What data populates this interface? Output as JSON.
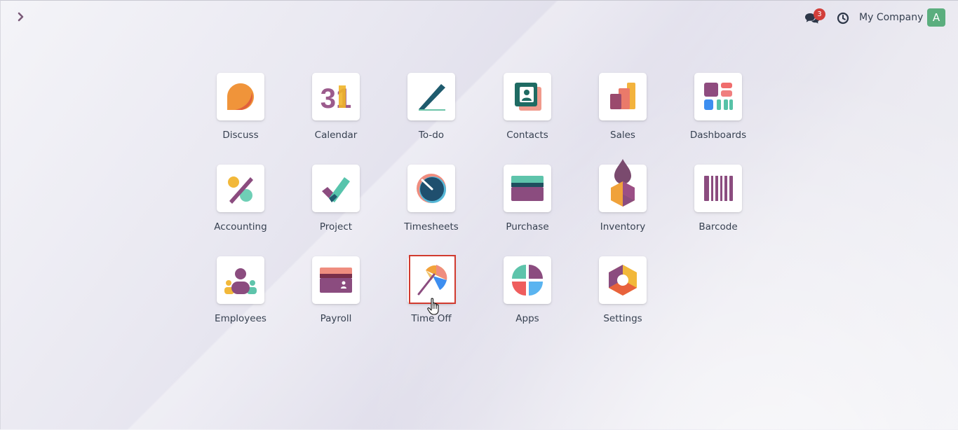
{
  "header": {
    "company": "My Company",
    "messages_count": "3",
    "avatar_initial": "A",
    "avatar_color": "#5bae7e"
  },
  "apps": [
    {
      "label": "Discuss",
      "icon": "discuss-icon"
    },
    {
      "label": "Calendar",
      "icon": "calendar-icon",
      "icon_text": "31"
    },
    {
      "label": "To-do",
      "icon": "todo-icon"
    },
    {
      "label": "Contacts",
      "icon": "contacts-icon"
    },
    {
      "label": "Sales",
      "icon": "sales-icon"
    },
    {
      "label": "Dashboards",
      "icon": "dashboards-icon"
    },
    {
      "label": "Accounting",
      "icon": "accounting-icon"
    },
    {
      "label": "Project",
      "icon": "project-icon"
    },
    {
      "label": "Timesheets",
      "icon": "timesheets-icon"
    },
    {
      "label": "Purchase",
      "icon": "purchase-icon"
    },
    {
      "label": "Inventory",
      "icon": "inventory-icon"
    },
    {
      "label": "Barcode",
      "icon": "barcode-icon"
    },
    {
      "label": "Employees",
      "icon": "employees-icon"
    },
    {
      "label": "Payroll",
      "icon": "payroll-icon"
    },
    {
      "label": "Time Off",
      "icon": "time-off-icon"
    },
    {
      "label": "Apps",
      "icon": "apps-icon"
    },
    {
      "label": "Settings",
      "icon": "settings-icon"
    }
  ],
  "highlighted_app": "Time Off"
}
